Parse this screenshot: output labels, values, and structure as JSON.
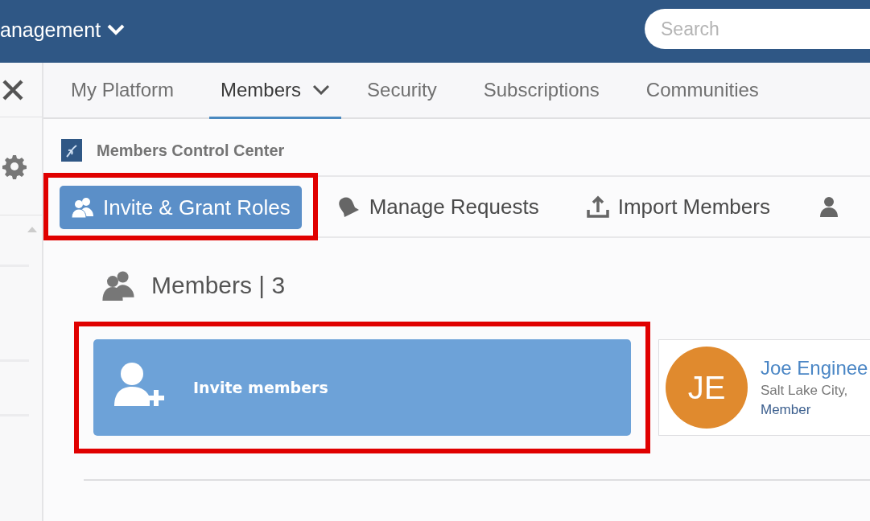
{
  "header": {
    "title": "anagement",
    "search_placeholder": "Search"
  },
  "tabs": [
    {
      "label": "My Platform",
      "selected": false,
      "has_menu": false
    },
    {
      "label": "Members",
      "selected": true,
      "has_menu": true
    },
    {
      "label": "Security",
      "selected": false,
      "has_menu": false
    },
    {
      "label": "Subscriptions",
      "selected": false,
      "has_menu": false
    },
    {
      "label": "Communities",
      "selected": false,
      "has_menu": false
    }
  ],
  "section_title": "Members Control Center",
  "actions": [
    {
      "label": "Invite & Grant Roles",
      "kind": "people",
      "selected": true,
      "highlighted": true
    },
    {
      "label": "Manage Requests",
      "kind": "bell",
      "selected": false,
      "highlighted": false
    },
    {
      "label": "Import Members",
      "kind": "upload",
      "selected": false,
      "highlighted": false
    },
    {
      "kind": "person",
      "selected": false,
      "highlighted": false
    }
  ],
  "members_heading": "Members | 3",
  "invite_tile": {
    "label": "Invite members",
    "highlighted": true
  },
  "members": [
    {
      "initials": "JE",
      "name": "Joe Enginee",
      "location": "Salt Lake City,",
      "role": "Member",
      "color": "#e08a2e"
    }
  ]
}
